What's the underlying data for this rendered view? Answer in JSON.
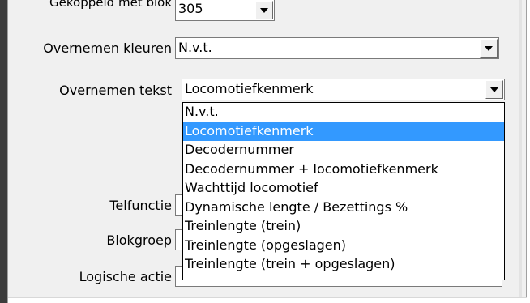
{
  "top": {
    "label": "Gekoppeld met blok",
    "value": "305"
  },
  "rows": {
    "overnemen_kleuren": {
      "label": "Overnemen kleuren",
      "value": "N.v.t."
    },
    "overnemen_tekst": {
      "label": "Overnemen tekst",
      "value": "Locomotiefkenmerk"
    },
    "telfunctie": {
      "label": "Telfunctie"
    },
    "blokgroep": {
      "label": "Blokgroep"
    },
    "logische_actie": {
      "label": "Logische actie"
    }
  },
  "dropdown": {
    "selected_index": 1,
    "options": [
      "N.v.t.",
      "Locomotiefkenmerk",
      "Decodernummer",
      "Decodernummer + locomotiefkenmerk",
      "Wachttijd locomotief",
      "Dynamische lengte / Bezettings %",
      "Treinlengte (trein)",
      "Treinlengte (opgeslagen)",
      "Treinlengte (trein +  opgeslagen)"
    ]
  },
  "icons": {
    "combo_arrow": "chevron-down-icon"
  }
}
